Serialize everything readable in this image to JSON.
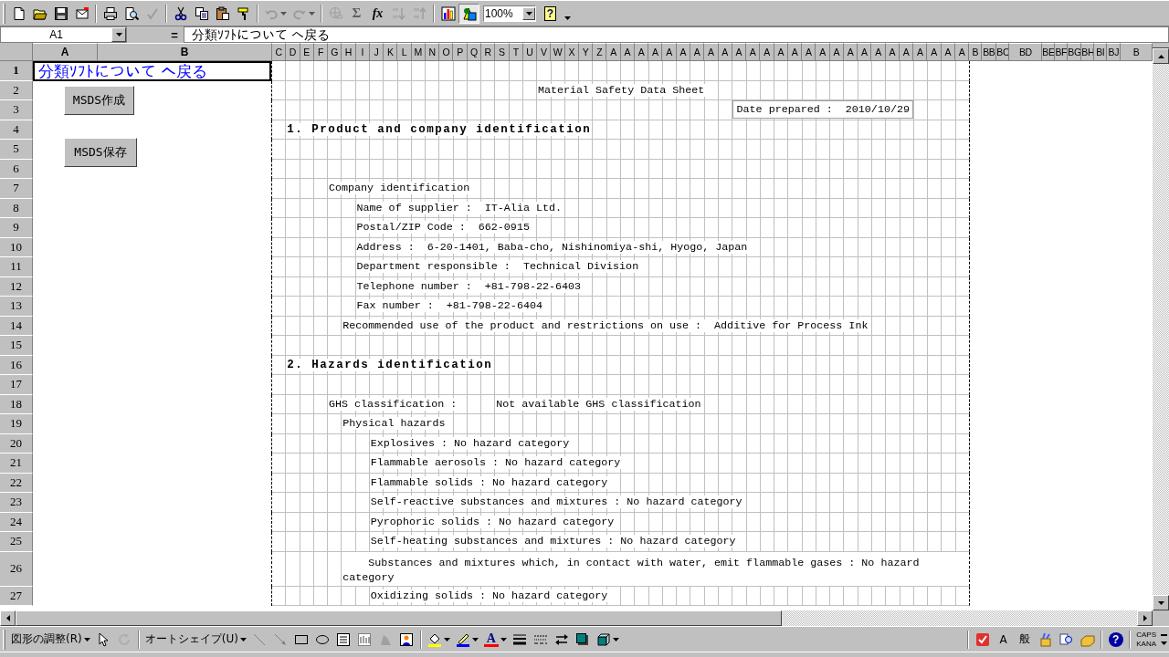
{
  "toolbar": {
    "tools": [
      {
        "disabled": false,
        "pressed": false
      },
      {
        "disabled": false,
        "pressed": false
      },
      {
        "disabled": false,
        "pressed": false
      },
      {
        "disabled": false,
        "pressed": false
      },
      {
        "disabled": false,
        "pressed": false
      },
      {
        "disabled": false,
        "pressed": false
      },
      {
        "disabled": true,
        "pressed": false
      },
      {
        "disabled": false,
        "pressed": false
      },
      {
        "disabled": false,
        "pressed": false
      },
      {
        "disabled": false,
        "pressed": false
      },
      {
        "disabled": false,
        "pressed": false
      },
      {
        "disabled": true,
        "pressed": false
      },
      {
        "disabled": true,
        "pressed": false
      },
      {
        "disabled": true,
        "pressed": false
      },
      {
        "label": "Σ",
        "disabled": false,
        "pressed": false
      },
      {
        "label": "fx",
        "disabled": false,
        "pressed": false
      },
      {
        "disabled": true,
        "pressed": false
      },
      {
        "disabled": true,
        "pressed": false
      },
      {
        "disabled": false,
        "pressed": false
      },
      {
        "disabled": false,
        "pressed": true
      },
      {
        "label": "?",
        "disabled": false,
        "pressed": false
      }
    ],
    "zoom": "100%"
  },
  "formula_bar": {
    "name_box": "A1",
    "equals": "=",
    "formula": "分類ｿﾌﾄについて へ戻る"
  },
  "sheet": {
    "columns": [
      "A",
      "B",
      "C",
      "D",
      "E",
      "F",
      "G",
      "H",
      "I",
      "J",
      "K",
      "L",
      "M",
      "N",
      "O",
      "P",
      "Q",
      "R",
      "S",
      "T",
      "U",
      "V",
      "W",
      "X",
      "Y",
      "Z",
      "A",
      "A",
      "A",
      "A",
      "A",
      "A",
      "A",
      "A",
      "A",
      "A",
      "A",
      "A",
      "A",
      "A",
      "A",
      "A",
      "A",
      "A",
      "A",
      "A",
      "A",
      "A",
      "A",
      "A",
      "A",
      "A",
      "B",
      "BB",
      "BC",
      "BD",
      "BE",
      "BF",
      "BG",
      "BH",
      "BI",
      "BJ",
      "B"
    ],
    "buttons": [
      "MSDS作成",
      "MSDS保存"
    ],
    "rows": [
      {
        "header": "1",
        "entries": [
          {
            "kind": "link",
            "text": "分類ｿﾌﾄについて へ戻る",
            "selected": true
          }
        ]
      },
      {
        "header": "2",
        "entries": [
          {
            "kind": "title",
            "text": "Material Safety Data Sheet"
          }
        ]
      },
      {
        "header": "3",
        "entries": [
          {
            "kind": "date",
            "text": "Date prepared :  2010/10/29"
          }
        ]
      },
      {
        "header": "4",
        "entries": [
          {
            "kind": "heading",
            "text": "1. Product and company identification"
          }
        ]
      },
      {
        "header": "5",
        "entries": []
      },
      {
        "header": "6",
        "entries": []
      },
      {
        "header": "7",
        "entries": [
          {
            "kind": "group",
            "text": "Company identification"
          }
        ]
      },
      {
        "header": "8",
        "entries": [
          {
            "kind": "field",
            "text": "Name of supplier :  IT-Alia Ltd."
          }
        ]
      },
      {
        "header": "9",
        "entries": [
          {
            "kind": "field",
            "text": "Postal/ZIP Code :  662-0915"
          }
        ]
      },
      {
        "header": "10",
        "entries": [
          {
            "kind": "field",
            "text": "Address :  6-20-1401, Baba-cho, Nishinomiya-shi, Hyogo, Japan"
          }
        ]
      },
      {
        "header": "11",
        "entries": [
          {
            "kind": "field",
            "text": "Department responsible :  Technical Division"
          }
        ]
      },
      {
        "header": "12",
        "entries": [
          {
            "kind": "field",
            "text": "Telephone number :  +81-798-22-6403"
          }
        ]
      },
      {
        "header": "13",
        "entries": [
          {
            "kind": "field",
            "text": "Fax number :  +81-798-22-6404"
          }
        ]
      },
      {
        "header": "14",
        "entries": [
          {
            "kind": "subgroup",
            "text": "Recommended use of the product and restrictions on use :  Additive for Process Ink"
          }
        ]
      },
      {
        "header": "15",
        "entries": []
      },
      {
        "header": "16",
        "entries": [
          {
            "kind": "heading",
            "text": "2. Hazards identification"
          }
        ]
      },
      {
        "header": "17",
        "entries": []
      },
      {
        "header": "18",
        "entries": [
          {
            "kind": "group",
            "text": "GHS classification :"
          },
          {
            "kind": "value",
            "text": "Not available GHS classification"
          }
        ]
      },
      {
        "header": "19",
        "entries": [
          {
            "kind": "subgroup",
            "text": "Physical hazards"
          }
        ]
      },
      {
        "header": "20",
        "entries": [
          {
            "kind": "item",
            "text": "Explosives : No hazard category"
          }
        ]
      },
      {
        "header": "21",
        "entries": [
          {
            "kind": "item",
            "text": "Flammable aerosols : No hazard category"
          }
        ]
      },
      {
        "header": "22",
        "entries": [
          {
            "kind": "item",
            "text": "Flammable solids : No hazard category"
          }
        ]
      },
      {
        "header": "23",
        "entries": [
          {
            "kind": "item",
            "text": "Self-reactive substances and mixtures : No hazard category"
          }
        ]
      },
      {
        "header": "24",
        "entries": [
          {
            "kind": "item",
            "text": "Pyrophoric solids : No hazard category"
          }
        ]
      },
      {
        "header": "25",
        "entries": [
          {
            "kind": "item",
            "text": "Self-heating substances and mixtures : No hazard category"
          }
        ]
      },
      {
        "header": "26",
        "entries": [
          {
            "kind": "wrapped",
            "text": "Substances and mixtures which, in contact with water, emit flammable gases : No hazard category"
          }
        ]
      },
      {
        "header": "27",
        "entries": [
          {
            "kind": "item",
            "text": "Oxidizing solids : No hazard category"
          }
        ]
      }
    ]
  },
  "drawing_toolbar": {
    "draw_menu": "図形の調整(R)",
    "autoshapes_menu": "オートシェイプ(U)",
    "tools": [
      {
        "disabled": false
      },
      {
        "disabled": true
      },
      {
        "disabled": false
      },
      {
        "disabled": false
      },
      {
        "disabled": false
      },
      {
        "disabled": false
      },
      {
        "disabled": false
      },
      {
        "disabled": false
      },
      {
        "disabled": false
      },
      {
        "disabled": false
      },
      {
        "disabled": false
      },
      {
        "disabled": false
      },
      {
        "label": "A",
        "disabled": false
      },
      {
        "disabled": false
      },
      {
        "disabled": false
      },
      {
        "disabled": false
      },
      {
        "disabled": false
      },
      {
        "disabled": false
      }
    ]
  },
  "ime_bar": {
    "mode_labels": [
      "A",
      "般"
    ],
    "help": "?",
    "caps": "CAPS",
    "kana": "KANA"
  }
}
